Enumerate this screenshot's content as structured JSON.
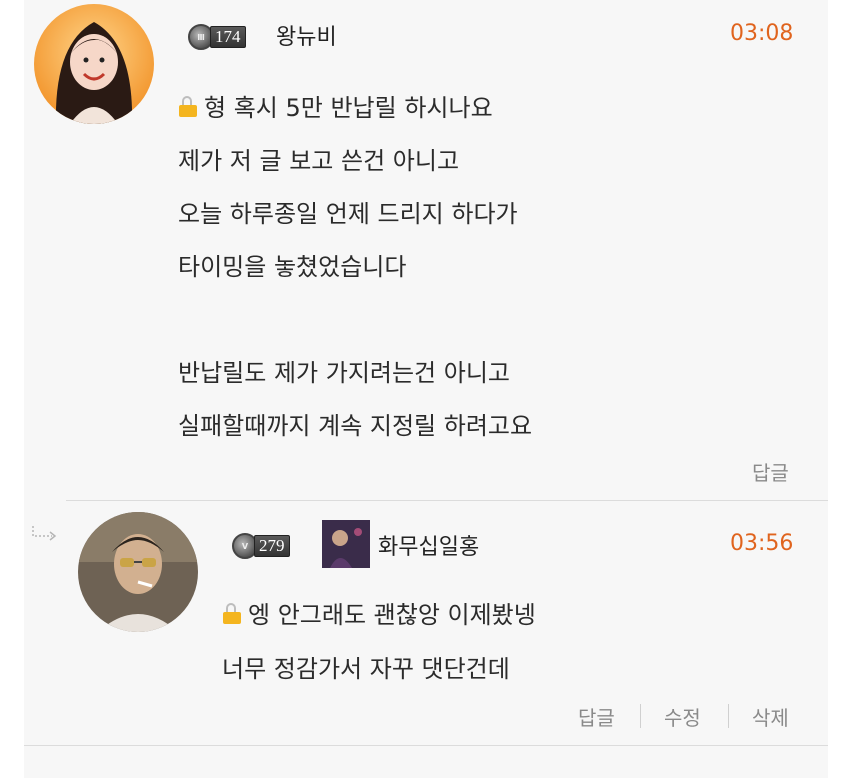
{
  "comments": [
    {
      "level": "174",
      "username": "왕뉴비",
      "time": "03:08",
      "lines": [
        "형 혹시 5만 반납릴 하시나요",
        "제가 저 글 보고 쓴건 아니고",
        "오늘 하루종일 언제 드리지 하다가",
        "타이밍을 놓쳤었습니다",
        "반납릴도 제가 가지려는건 아니고",
        "실패할때까지 계속 지정릴 하려고요"
      ],
      "reply_label": "답글"
    },
    {
      "level": "279",
      "username": "화무십일홍",
      "time": "03:56",
      "lines": [
        "엥 안그래도 괜찮앙 이제봤넹",
        "너무 정감가서 자꾸 댓단건데"
      ],
      "reply_label": "답글",
      "edit_label": "수정",
      "delete_label": "삭제"
    }
  ],
  "colors": {
    "time": "#e0641e",
    "lock": "#f4b51f",
    "panel": "#f7f7f7"
  },
  "icons": [
    "lock-icon",
    "level-badge-icon",
    "reply-arrow-icon"
  ]
}
